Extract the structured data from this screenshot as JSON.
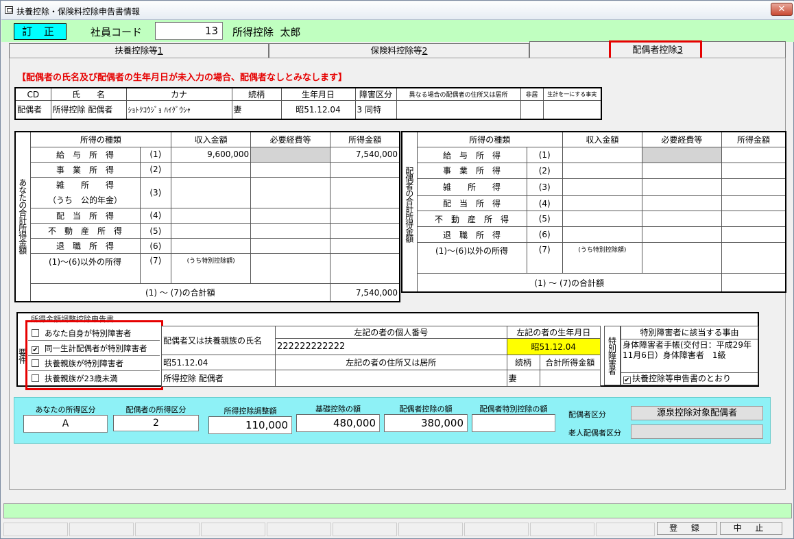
{
  "window": {
    "title": "扶養控除・保険料控除申告書情報",
    "close": "✕"
  },
  "header": {
    "mode": "訂 正",
    "employee_code_label": "社員コード",
    "employee_code": "13",
    "employee_name": "所得控除  太郎"
  },
  "tabs": [
    {
      "label": "扶養控除等",
      "key": "1"
    },
    {
      "label": "保険料控除等",
      "key": "2"
    },
    {
      "label": "配偶者控除",
      "key": "3"
    }
  ],
  "notice": "【配偶者の氏名及び配偶者の生年月日が未入力の場合、配偶者なしとみなします】",
  "spouse_table": {
    "headers": [
      "CD",
      "氏　　名",
      "カナ",
      "続柄",
      "生年月日",
      "障害区分",
      "異なる場合の配偶者の住所又は居所",
      "非居",
      "生計を一にする事実"
    ],
    "row": {
      "cd": "配偶者",
      "name": "所得控除 配偶者",
      "kana": "ｼｮﾄｸｺｳｼﾞｮ ﾊｲｸﾞｳｼｬ",
      "relation": "妻",
      "birth": "昭51.12.04",
      "dis_code": "3",
      "dis_name": "同特",
      "address": "",
      "nonres": "",
      "fact": ""
    }
  },
  "income_headers": {
    "type": "所得の種類",
    "revenue": "収入金額",
    "expenses": "必要経費等",
    "income": "所得金額"
  },
  "income_rows": [
    {
      "name": "給　与　所　得",
      "no": "(1)"
    },
    {
      "name": "事　業　所　得",
      "no": "(2)"
    },
    {
      "name": "雑　　所　　得",
      "sub": "（うち　公的年金）",
      "no": "(3)"
    },
    {
      "name": "配　当　所　得",
      "no": "(4)"
    },
    {
      "name": "不　動　産　所　得",
      "no": "(5)"
    },
    {
      "name": "退　職　所　得",
      "no": "(6)"
    },
    {
      "name": "(1)～(6)以外の所得",
      "no": "(7)",
      "note": "(うち特別控除額)"
    }
  ],
  "your_income": {
    "side_label": "あなたの合計所得金額",
    "salary_revenue": "9,600,000",
    "salary_income": "7,540,000",
    "total_label": "(1) ～ (7)の合計額",
    "total": "7,540,000"
  },
  "spouse_income": {
    "side_label": "配偶者の合計所得金額",
    "total_label": "(1) ～ (7)の合計額",
    "total": ""
  },
  "adjustment": {
    "title": "所得金額調整控除申告書",
    "side_label": "要件",
    "checks": [
      {
        "label": "あなた自身が特別障害者",
        "checked": false
      },
      {
        "label": "同一生計配偶者が特別障害者",
        "checked": true
      },
      {
        "label": "扶養親族が特別障害者",
        "checked": false
      },
      {
        "label": "扶養親族が23歳未満",
        "checked": false
      }
    ],
    "name_header": "配偶者又は扶養親族の氏名",
    "number_header": "左記の者の個人番号",
    "birth_header": "左記の者の生年月日",
    "number": "222222222222",
    "birth": "昭51.12.04",
    "address_header": "左記の者の住所又は居所",
    "relation_header": "続柄",
    "income_header": "合計所得金額",
    "birth2": "昭51.12.04",
    "name": "所得控除 配偶者",
    "relation": "妻",
    "disabled_label": "特別障害者",
    "reason_header": "特別障害者に該当する事由",
    "reason": "身体障害者手帳(交付日：平成29年11月6日）身体障害者　1級",
    "same_as": "扶養控除等申告書のとおり"
  },
  "summary": {
    "your_class_label": "あなたの所得区分",
    "your_class": "A",
    "spouse_class_label": "配偶者の所得区分",
    "spouse_class": "2",
    "adj_label": "所得控除調整額",
    "adj": "110,000",
    "basic_label": "基礎控除の額",
    "basic": "480,000",
    "spouse_ded_label": "配偶者控除の額",
    "spouse_ded": "380,000",
    "spouse_special_label": "配偶者特別控除の額",
    "spouse_special": "",
    "spouse_kind_label": "配偶者区分",
    "spouse_kind": "源泉控除対象配偶者",
    "elder_label": "老人配偶者区分",
    "elder": ""
  },
  "buttons": {
    "register": "登 録",
    "cancel": "中 止"
  }
}
